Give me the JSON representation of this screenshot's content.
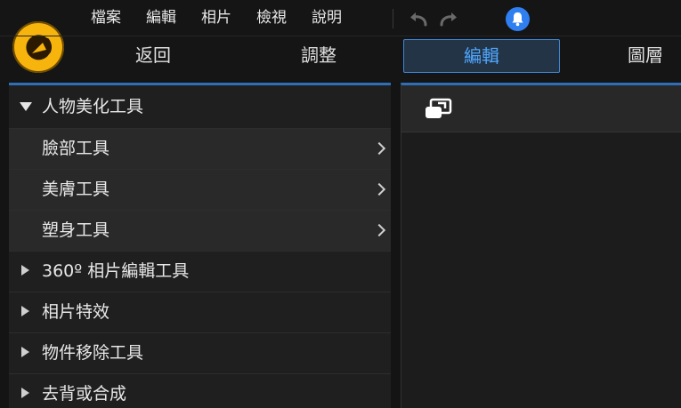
{
  "menubar": {
    "items": [
      "檔案",
      "編輯",
      "相片",
      "檢視",
      "說明"
    ]
  },
  "tabs": [
    {
      "label": "返回"
    },
    {
      "label": "調整"
    },
    {
      "label": "編輯",
      "active": true
    },
    {
      "label": "圖層"
    }
  ],
  "panel": {
    "group_beauty": "人物美化工具",
    "sub_items": [
      "臉部工具",
      "美膚工具",
      "塑身工具"
    ],
    "groups": [
      "360º 相片編輯工具",
      "相片特效",
      "物件移除工具",
      "去背或合成"
    ]
  },
  "colors": {
    "accent": "#3f86d4",
    "active_tab_text": "#4ea7ff",
    "notification": "#2f7ff0",
    "logo": "#f6b40d"
  }
}
